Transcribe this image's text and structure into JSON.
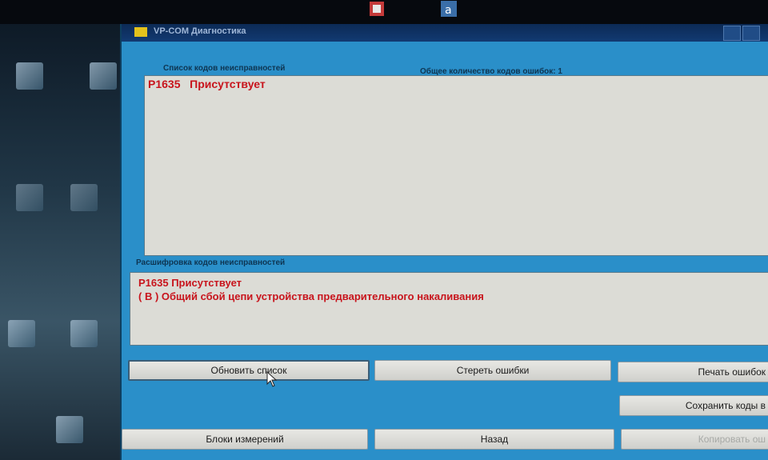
{
  "window": {
    "title": "VP-COM  Диагностика"
  },
  "fault_list": {
    "header": "Список кодов неисправностей",
    "count_label": "Общее количество кодов ошибок: 1",
    "items": [
      {
        "code": "P1635",
        "status": "Присутствует"
      }
    ]
  },
  "decode": {
    "header": "Расшифровка кодов неисправностей",
    "line1": "P1635  Присутствует",
    "line2": "( В )  Общий сбой цепи устройства предварительного накаливания"
  },
  "buttons": {
    "refresh": "Обновить список",
    "erase": "Стереть ошибки",
    "print": "Печать ошибок",
    "save": "Сохранить коды в",
    "measure": "Блоки измерений",
    "back": "Назад",
    "copy": "Копировать ош"
  },
  "colors": {
    "window_bg": "#2a8fc9",
    "panel_bg": "#dcdcd6",
    "fault_text": "#c8141c"
  }
}
